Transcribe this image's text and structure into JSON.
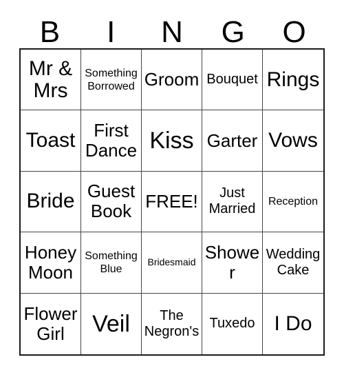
{
  "card": {
    "title": "BINGO Card",
    "header_letters": [
      "B",
      "I",
      "N",
      "G",
      "O"
    ],
    "free_space_index": 12,
    "colors": {
      "background": "#ffffff",
      "text": "#000000",
      "grid_line": "#444444",
      "outer_border": "#1a1a1a"
    },
    "grid": {
      "columns": 5,
      "rows": 5,
      "cells": [
        {
          "text": "Mr & Mrs",
          "size": "lg"
        },
        {
          "text": "Something Borrowed",
          "size": "xs"
        },
        {
          "text": "Groom",
          "size": "md"
        },
        {
          "text": "Bouquet",
          "size": "sm"
        },
        {
          "text": "Rings",
          "size": "lg"
        },
        {
          "text": "Toast",
          "size": "lg"
        },
        {
          "text": "First Dance",
          "size": "md"
        },
        {
          "text": "Kiss",
          "size": "xl"
        },
        {
          "text": "Garter",
          "size": "md"
        },
        {
          "text": "Vows",
          "size": "lg"
        },
        {
          "text": "Bride",
          "size": "lg"
        },
        {
          "text": "Guest Book",
          "size": "md"
        },
        {
          "text": "FREE!",
          "size": "md"
        },
        {
          "text": "Just Married",
          "size": "sm"
        },
        {
          "text": "Reception",
          "size": "xs"
        },
        {
          "text": "Honey Moon",
          "size": "md"
        },
        {
          "text": "Something Blue",
          "size": "xs"
        },
        {
          "text": "Bridesmaid",
          "size": "xxs"
        },
        {
          "text": "Shower",
          "size": "md"
        },
        {
          "text": "Wedding Cake",
          "size": "sm"
        },
        {
          "text": "Flower Girl",
          "size": "md"
        },
        {
          "text": "Veil",
          "size": "xl"
        },
        {
          "text": "The Negron's",
          "size": "sm"
        },
        {
          "text": "Tuxedo",
          "size": "sm"
        },
        {
          "text": "I Do",
          "size": "lg"
        }
      ]
    }
  }
}
